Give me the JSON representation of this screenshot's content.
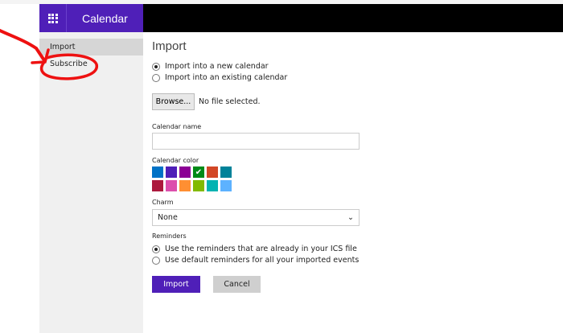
{
  "header": {
    "app_title": "Calendar",
    "waffle_icon": "app-launcher-icon"
  },
  "sidebar": {
    "items": [
      {
        "label": "Import",
        "selected": true
      },
      {
        "label": "Subscribe",
        "selected": false
      }
    ]
  },
  "main": {
    "title": "Import",
    "import_target": {
      "options": [
        "Import into a new calendar",
        "Import into an existing calendar"
      ],
      "selected": 0
    },
    "file": {
      "browse_label": "Browse...",
      "status": "No file selected."
    },
    "calendar_name": {
      "label": "Calendar name",
      "value": ""
    },
    "calendar_color": {
      "label": "Calendar color",
      "selected": 3,
      "colors": [
        "#0072c6",
        "#4f1fb8",
        "#8c0095",
        "#008a17",
        "#d24726",
        "#008299",
        "#ac193d",
        "#dc4fad",
        "#ff8f32",
        "#82ba00",
        "#03b3b2",
        "#5db2ff"
      ]
    },
    "charm": {
      "label": "Charm",
      "value": "None"
    },
    "reminders": {
      "label": "Reminders",
      "options": [
        "Use the reminders that are already in your ICS file",
        "Use default reminders for all your imported events"
      ],
      "selected": 0
    },
    "import_button": "Import",
    "cancel_button": "Cancel"
  },
  "annotation_color": "#ee1111"
}
